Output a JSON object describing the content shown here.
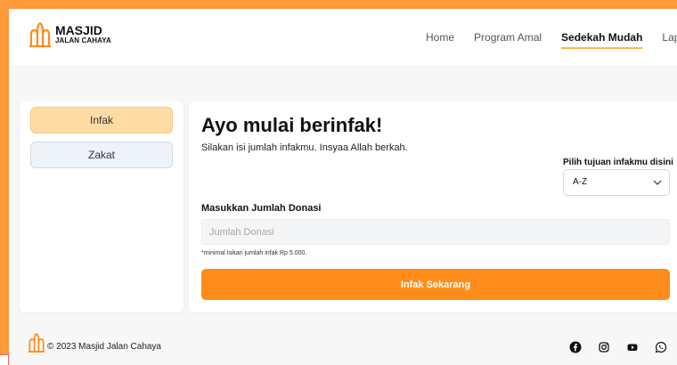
{
  "brand": {
    "line1": "MASJID",
    "line2": "JALAN CAHAYA",
    "logo_icon": "mosque-icon",
    "logo_color": "#ff8c1a"
  },
  "nav": {
    "items": [
      {
        "label": "Home",
        "active": false
      },
      {
        "label": "Program Amal",
        "active": false
      },
      {
        "label": "Sedekah Mudah",
        "active": true
      },
      {
        "label": "Laporan",
        "active": false
      }
    ]
  },
  "sidebar": {
    "tabs": [
      {
        "label": "Infak",
        "selected": true
      },
      {
        "label": "Zakat",
        "selected": false
      }
    ]
  },
  "main": {
    "title": "Ayo mulai berinfak!",
    "subtitle": "Silakan isi jumlah infakmu. Insyaa Allah berkah.",
    "purpose": {
      "label": "Pilih tujuan infakmu disini",
      "value": "A-Z"
    },
    "amount": {
      "label": "Masukkan Jumlah Donasi",
      "placeholder": "Jumlah Donasi",
      "value": ""
    },
    "hint": "*minimal isikan jumlah infak Rp 5.000.",
    "submit_label": "Infak Sekarang"
  },
  "footer": {
    "copyright": "© 2023 Masjid Jalan Cahaya",
    "socials": [
      "facebook-icon",
      "instagram-icon",
      "youtube-icon",
      "whatsapp-icon"
    ]
  },
  "colors": {
    "accent": "#ff8c1a",
    "background": "#ff9b3c",
    "tab_active": "#ffdca3",
    "nav_underline": "#ffb84d"
  }
}
